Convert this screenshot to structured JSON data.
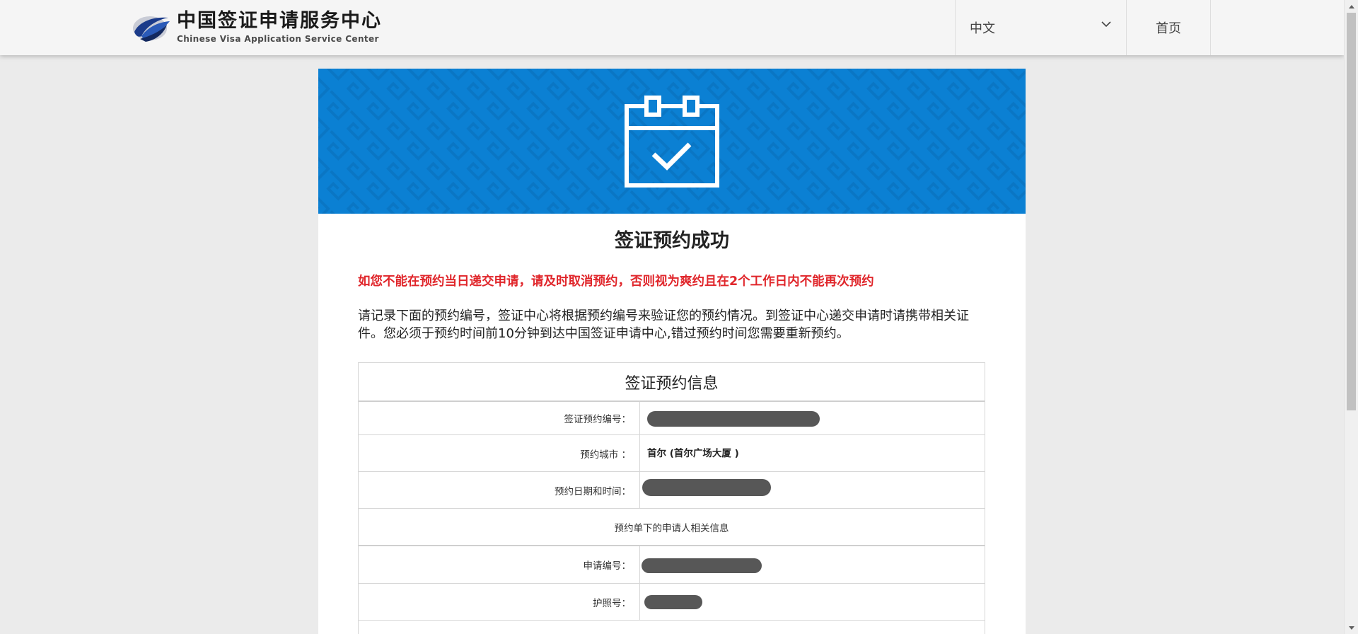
{
  "header": {
    "logo_cn": "中国签证申请服务中心",
    "logo_en": "Chinese Visa Application Service Center",
    "language_selected": "中文",
    "home_label": "首页"
  },
  "banner": {
    "icon": "calendar-check-icon",
    "color": "#0b80d3"
  },
  "content": {
    "title": "签证预约成功",
    "warning": "如您不能在预约当日递交申请，请及时取消预约，否则视为爽约且在2个工作日内不能再次预约",
    "warning_color": "#e0262b",
    "intro": "请记录下面的预约编号，签证中心将根据预约编号来验证您的预约情况。到签证中心递交申请时请携带相关证件。您必须于预约时间前10分钟到达中国签证申请中心,错过预约时间您需要重新预约。"
  },
  "info_table": {
    "title": "签证预约信息",
    "rows": [
      {
        "label": "签证预约编号：",
        "value": ""
      },
      {
        "label": "预约城市 ：",
        "value": "首尔 (首尔广场大厦 )"
      },
      {
        "label": "预约日期和时间：",
        "value": ""
      }
    ],
    "applicant_section": "预约单下的申请人相关信息",
    "applicant_rows": [
      {
        "label": "申请编号：",
        "value": ""
      },
      {
        "label": "护照号：",
        "value": ""
      }
    ]
  }
}
